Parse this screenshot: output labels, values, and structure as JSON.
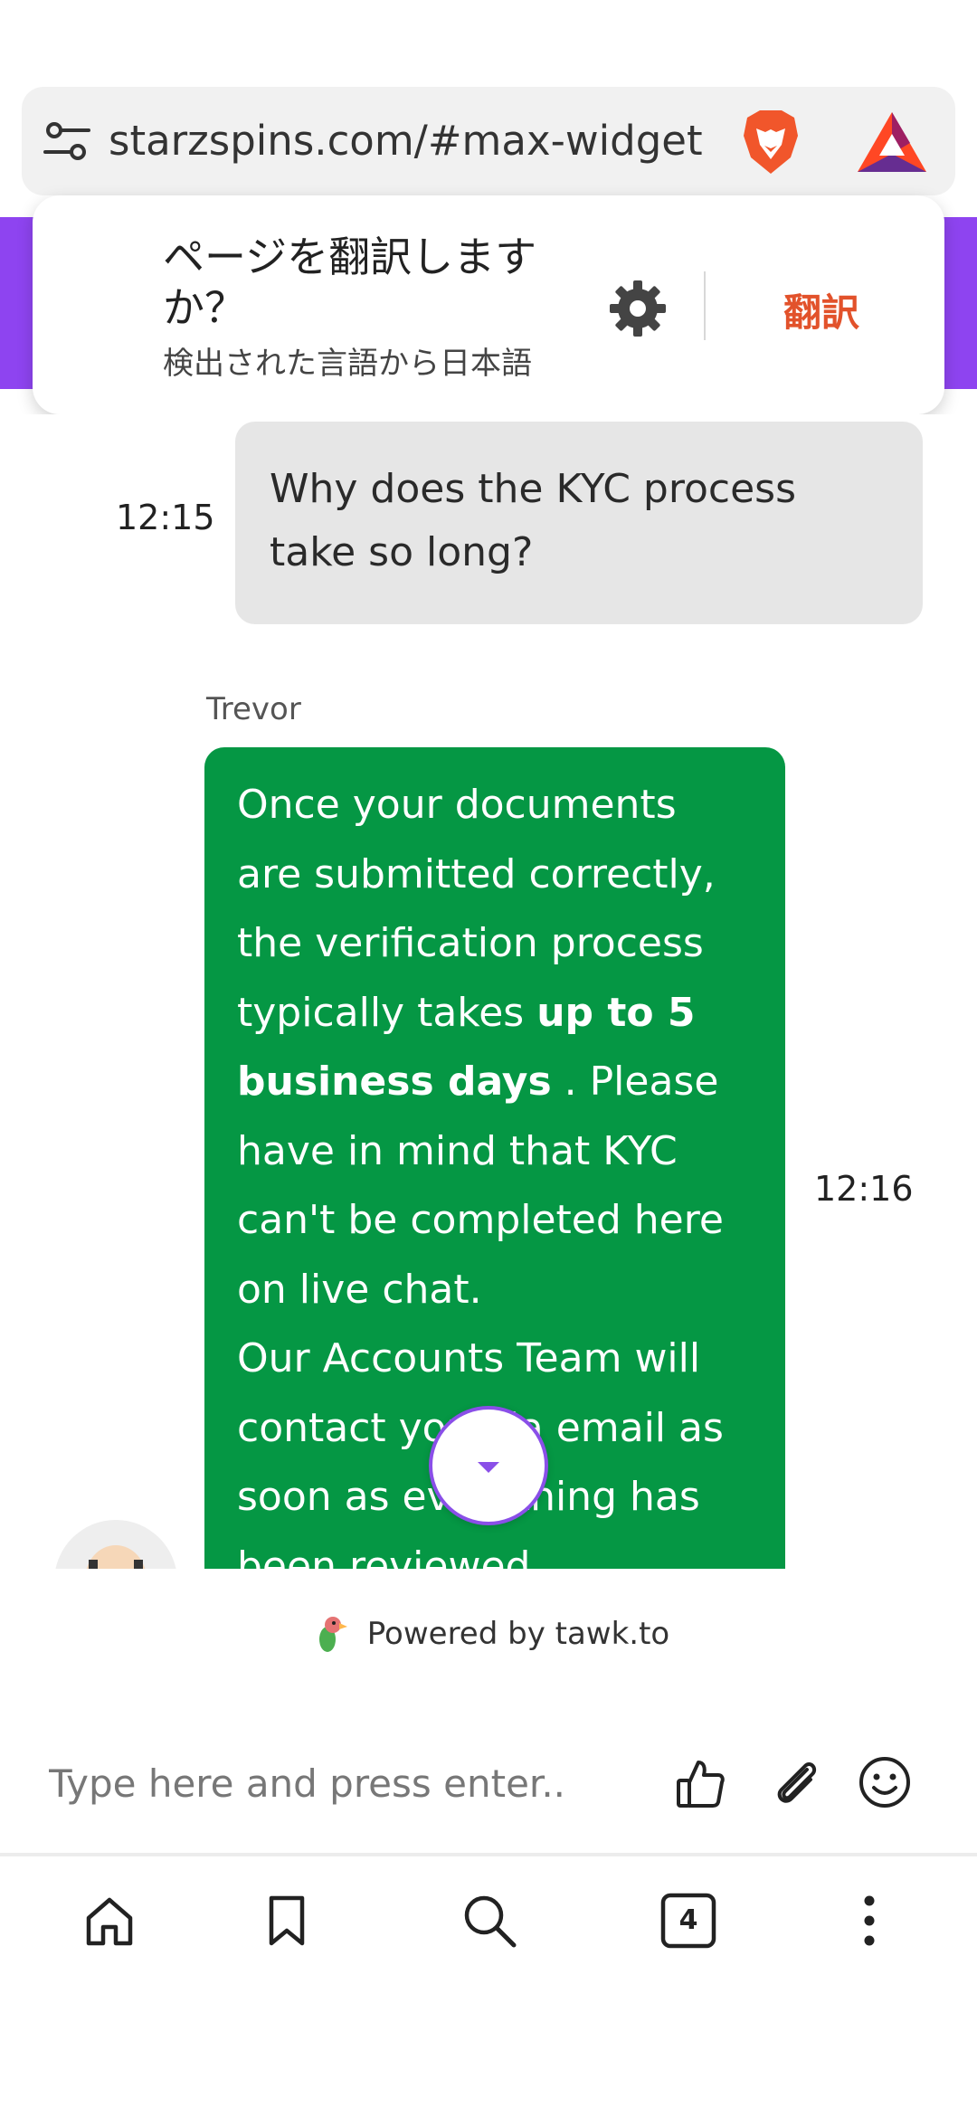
{
  "browser": {
    "url": "starzspins.com/#max-widget",
    "icons": {
      "settings": "tune-icon",
      "brave": "brave-lion-icon",
      "rewards": "bat-triangle-icon"
    }
  },
  "translate_popup": {
    "title": "ページを翻訳しますか？",
    "subtitle": "検出された言語から日本語",
    "action_label": "翻訳",
    "accent_color": "#e2522b"
  },
  "chat": {
    "user_message": {
      "time": "12:15",
      "text": "Why does the KYC process take so long?"
    },
    "agent_message": {
      "sender": "Trevor",
      "time": "12:16",
      "part1": "Once your documents are submitted correctly, the verification process typically takes ",
      "bold": "up to 5 business days",
      "part2": " . Please have in mind that KYC can't be completed here on live chat.",
      "part3": "Our Accounts Team will contact you via email as soon as everything has been reviewed."
    },
    "bubble_color": "#059744",
    "widget_accent": "#8e44f0"
  },
  "footer": {
    "powered_by": "Powered by tawk.to",
    "input_placeholder": "Type here and press enter.."
  },
  "nav": {
    "tab_count": "4",
    "items": [
      "home-icon",
      "bookmark-icon",
      "search-icon",
      "tabs-icon",
      "more-icon"
    ]
  }
}
